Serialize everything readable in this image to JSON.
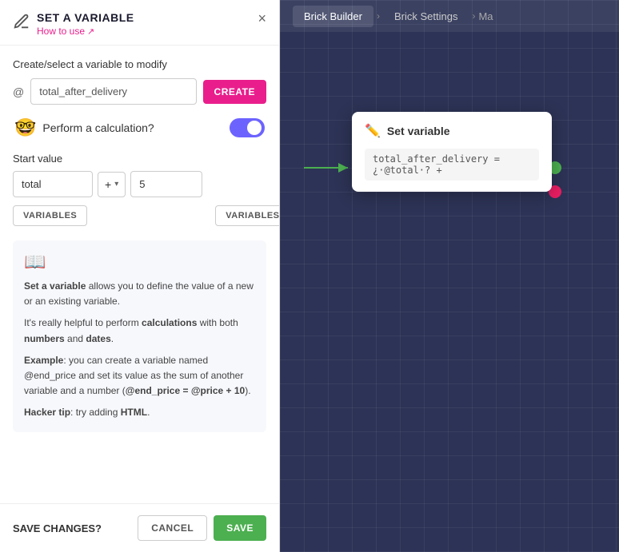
{
  "header": {
    "title": "SET A VARIABLE",
    "how_to_use": "How to use",
    "close_label": "×"
  },
  "variable_section": {
    "label": "Create/select a variable to modify",
    "at_symbol": "@",
    "input_value": "total_after_delivery",
    "input_placeholder": "total_after_delivery",
    "create_button": "CREATE"
  },
  "calculation": {
    "emoji": "🤓",
    "label": "Perform a calculation?",
    "toggle_on": true
  },
  "start_value": {
    "label": "Start value",
    "left_input": "total",
    "operator": "+",
    "right_input": "5",
    "variables_btn_left": "VARIABLES",
    "variables_btn_right": "VARIABLES"
  },
  "info_box": {
    "icon": "📖",
    "paragraphs": [
      {
        "id": "p1",
        "text": "Set a variable allows you to define the value of a new or an existing variable."
      },
      {
        "id": "p2",
        "text": "It's really helpful to perform calculations with both numbers and dates."
      },
      {
        "id": "p3",
        "text": "Example: you can create a variable named @end_price and set its value as the sum of another variable and a number (@end_price = @price + 10)."
      },
      {
        "id": "p4",
        "text": "Hacker tip: try adding HTML."
      }
    ]
  },
  "footer": {
    "save_changes_label": "SAVE CHANGES?",
    "cancel_button": "CANCEL",
    "save_button": "SAVE"
  },
  "right_panel": {
    "nav": {
      "tab1": "Brick Builder",
      "tab2": "Brick Settings",
      "tab3": "Ma"
    },
    "card": {
      "icon": "✏️",
      "title": "Set variable",
      "formula": "total_after_delivery = ¿·@total·? +"
    }
  }
}
